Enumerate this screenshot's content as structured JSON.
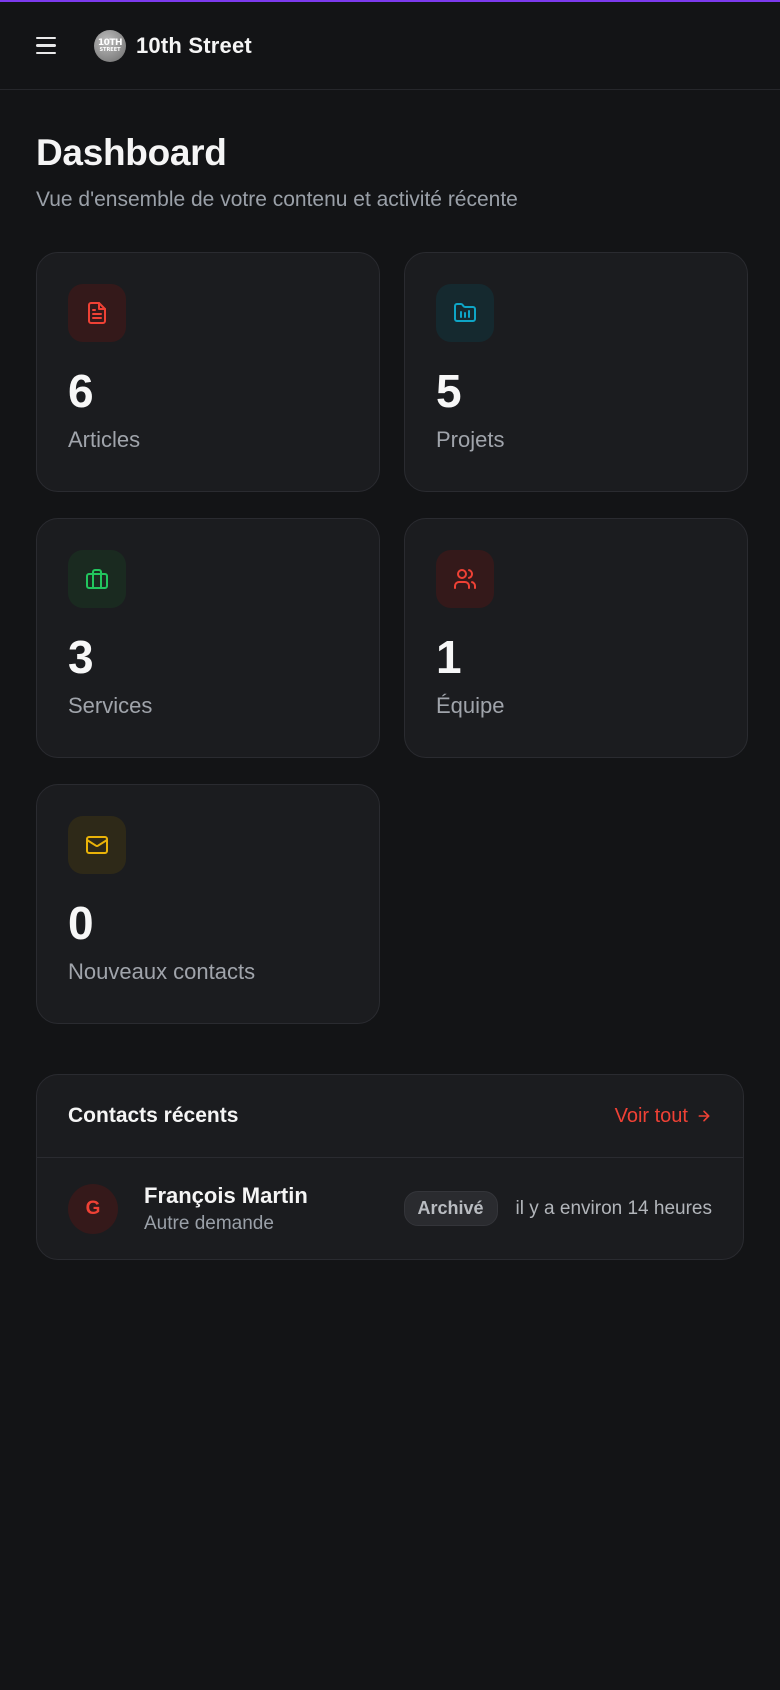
{
  "app": {
    "brand_name": "10th Street",
    "logo_text_top": "10TH",
    "logo_text_bottom": "STREET"
  },
  "page": {
    "title": "Dashboard",
    "subtitle": "Vue d'ensemble de votre contenu et activité récente"
  },
  "stats": [
    {
      "value": "6",
      "label": "Articles",
      "icon": "document-icon",
      "color": "#ef4135",
      "bg": "#34191a"
    },
    {
      "value": "5",
      "label": "Projets",
      "icon": "folder-chart-icon",
      "color": "#0ea5c6",
      "bg": "#15292f"
    },
    {
      "value": "3",
      "label": "Services",
      "icon": "briefcase-icon",
      "color": "#22c55e",
      "bg": "#1a2a20"
    },
    {
      "value": "1",
      "label": "Équipe",
      "icon": "users-icon",
      "color": "#ef4135",
      "bg": "#34191a"
    },
    {
      "value": "0",
      "label": "Nouveaux contacts",
      "icon": "mail-icon",
      "color": "#eab308",
      "bg": "#2e2918"
    }
  ],
  "recent_contacts": {
    "title": "Contacts récents",
    "see_all_label": "Voir tout",
    "items": [
      {
        "initial": "G",
        "name": "François Martin",
        "type": "Autre demande",
        "status": "Archivé",
        "time": "il y a environ 14 heures"
      }
    ]
  },
  "colors": {
    "accent": "#ef4135",
    "top_line": "#7c3aed",
    "background": "#131416",
    "card": "#1b1c1f"
  }
}
